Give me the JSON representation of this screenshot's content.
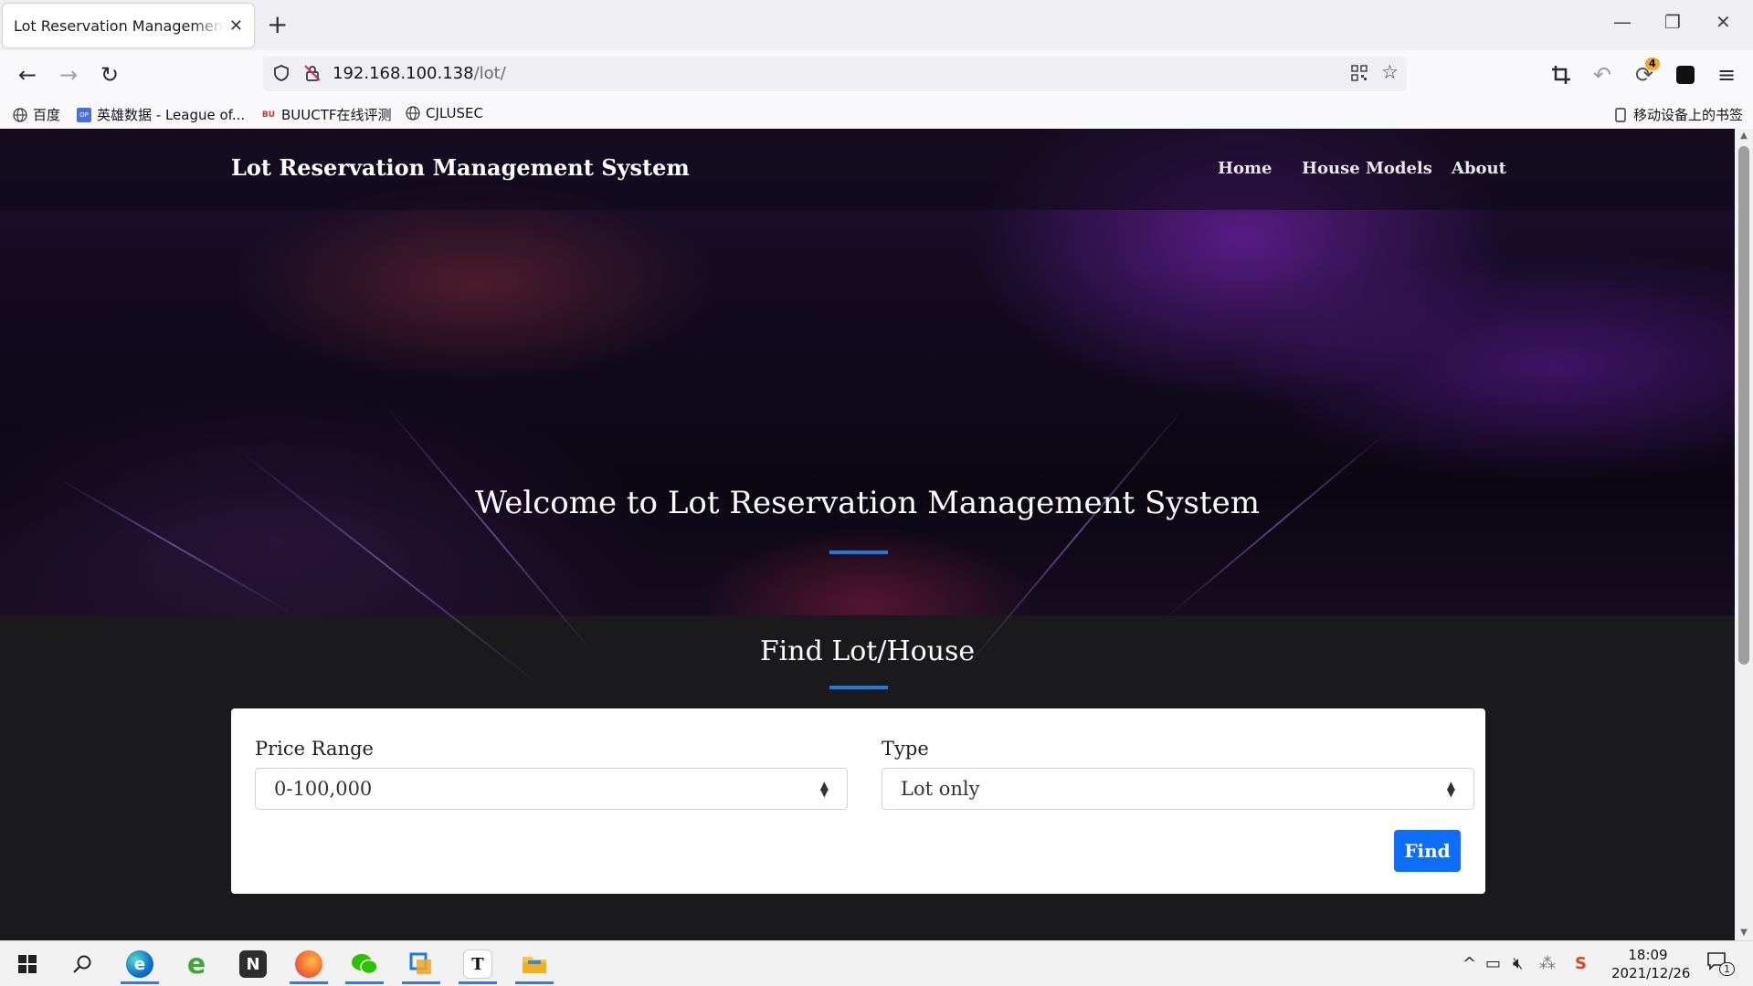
{
  "browser": {
    "tab_title": "Lot Reservation Management System",
    "url_host": "192.168.100.138",
    "url_path": "/lot/",
    "extension_badge": "4",
    "bookmarks": [
      "百度",
      "英雄数据 - League of...",
      "BUUCTF在线评测",
      "CJLUSEC"
    ],
    "mobile_bookmarks": "移动设备上的书签"
  },
  "site": {
    "brand": "Lot Reservation Management System",
    "nav": [
      "Home",
      "House Models",
      "About"
    ],
    "hero_title": "Welcome to Lot Reservation Management System",
    "find_title": "Find Lot/House",
    "form": {
      "price_label": "Price Range",
      "price_value": "0-100,000",
      "type_label": "Type",
      "type_value": "Lot only",
      "find_button": "Find"
    }
  },
  "taskbar": {
    "time": "18:09",
    "date": "2021/12/26",
    "notification_count": "1",
    "apps": [
      "start-icon",
      "search-icon",
      "edge-icon",
      "ie-icon",
      "notion-icon",
      "firefox-icon",
      "wechat-icon",
      "virtualbox-icon",
      "typora-icon",
      "file-explorer-icon"
    ]
  },
  "colors": {
    "accent": "#1f7ae0",
    "button": "#0d6efd",
    "section_bg": "#1a1a1d"
  }
}
